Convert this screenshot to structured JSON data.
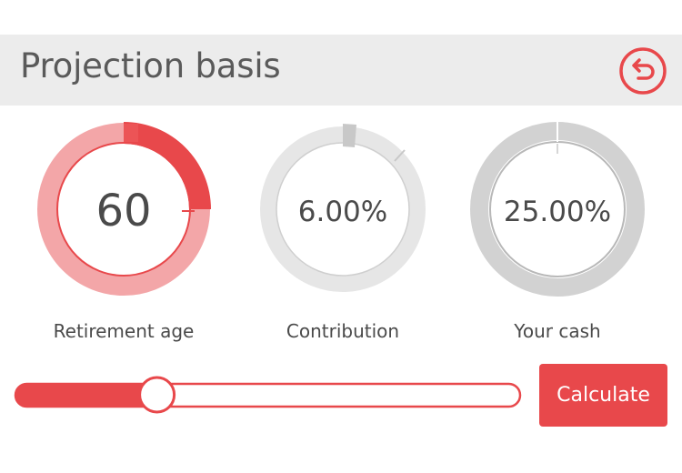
{
  "header": {
    "title": "Projection basis",
    "reset_icon": "undo-arrow-icon"
  },
  "dials": [
    {
      "value": "60",
      "label": "Retirement age"
    },
    {
      "value": "6.00%",
      "label": "Contribution"
    },
    {
      "value": "25.00%",
      "label": "Your cash"
    }
  ],
  "slider": {
    "level": 0.27
  },
  "actions": {
    "calculate_label": "Calculate"
  },
  "colors": {
    "accent": "#e8484b",
    "accent_light": "#f3a6a8",
    "neutral_ring": "#e6e6e6",
    "neutral_ring_dark": "#c8c8c8",
    "header_bg": "#ececec",
    "text": "#4a4a4a"
  }
}
